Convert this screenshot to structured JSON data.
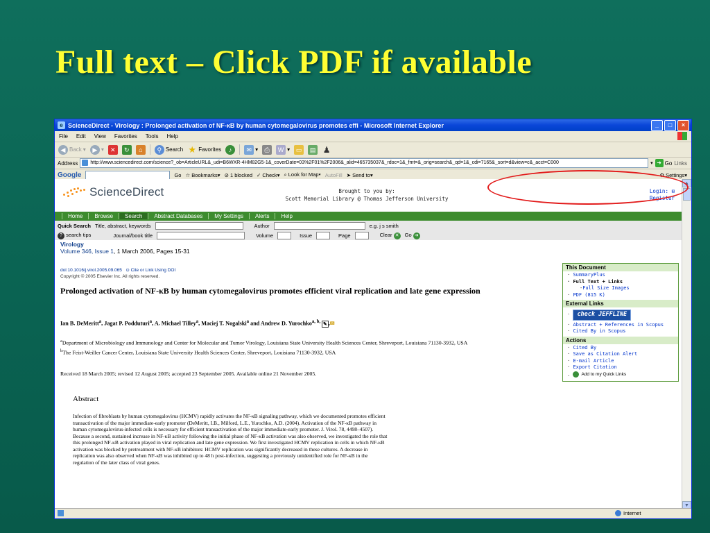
{
  "slide": {
    "title": "Full text – Click PDF if  available"
  },
  "browser": {
    "window_title": "ScienceDirect - Virology : Prolonged activation of NF-κB by human cytomegalovirus promotes effi - Microsoft Internet Explorer",
    "menu": [
      "File",
      "Edit",
      "View",
      "Favorites",
      "Tools",
      "Help"
    ],
    "toolbar": {
      "back": "Back",
      "search": "Search",
      "favorites": "Favorites"
    },
    "address": {
      "label": "Address",
      "url": "http://www.sciencedirect.com/science?_ob=ArticleURL&_udi=B6WXR-4HM82G5-1&_coverDate=03%2F01%2F2006&_alid=465735037&_rdoc=1&_fmt=&_orig=search&_qd=1&_cdi=7165&_sort=d&view=c&_acct=C000",
      "go": "Go",
      "links": "Links"
    },
    "google": {
      "logo": "Google",
      "go": "Go",
      "bookmarks": "Bookmarks",
      "blocked": "1 blocked",
      "check": "Check",
      "lookup": "Look for Map",
      "autofill": "AutoFill",
      "sendto": "Send to",
      "settings": "Settings"
    },
    "status": {
      "zone": "Internet"
    }
  },
  "page": {
    "logo": "ScienceDirect",
    "brought_by": "Brought to you by:",
    "library": "Scott Memorial Library @ Thomas Jefferson University",
    "login": "Login:",
    "register": "Register",
    "nav": [
      "Home",
      "Browse",
      "Search",
      "Abstract Databases",
      "My Settings",
      "Alerts",
      "Help"
    ],
    "quick_search": {
      "label": "Quick Search",
      "field1": "Title, abstract, keywords",
      "author": "Author",
      "example": "e.g. j s smith",
      "tips": "search tips",
      "journal": "Journal/book title",
      "volume": "Volume",
      "issue": "Issue",
      "page": "Page",
      "clear": "Clear",
      "go": "Go"
    },
    "journal": {
      "name": "Virology",
      "volume_issue": "Volume 346, Issue 1",
      "date_pages": ", 1 March 2006, Pages 15-31"
    },
    "doi": "doi:10.1016/j.virol.2005.09.065",
    "cite_link": "Cite or Link Using DOI",
    "copyright": "Copyright © 2005 Elsevier Inc. All rights reserved.",
    "article_title": "Prolonged activation of NF-κB by human cytomegalovirus promotes efficient viral replication and late gene expression",
    "authors": "Ian B. DeMeritt<sup>a</sup>, Jagat P. Podduturi<sup>a</sup>, A. Michael Tilley<sup>a</sup>, Maciej T. Nogalski<sup>a</sup> and Andrew D. Yurochko<sup>a, b, </sup>",
    "affil_a": "Department of Microbiology and Immunology and Center for Molecular and Tumor Virology, Louisiana State University Health Sciences Center, Shreveport, Louisiana 71130-3932, USA",
    "affil_b": "The Feist-Weiller Cancer Center, Louisiana State University Health Sciences Center, Shreveport, Louisiana 71130-3932, USA",
    "received": "Received 18 March 2005;  revised 12 August 2005;  accepted 23 September 2005.  Available online 21 November 2005.",
    "abstract_heading": "Abstract",
    "abstract": "Infection of fibroblasts by human cytomegalovirus (HCMV) rapidly activates the NF-κB signaling pathway, which we documented promotes efficient transactivation of the major immediate-early promoter (DeMeritt, I.B., Milford, L.E., Yurochko, A.D. (2004). Activation of the NF-κB pathway in human cytomegalovirus-infected cells is necessary for efficient transactivation of the major immediate-early promoter. J. Virol. 78, 4498–4507). Because a second, sustained increase in NF-κB activity following the initial phase of NF-κB activation was also observed, we investigated the role that this prolonged NF-κB activation played in viral replication and late gene expression. We first investigated HCMV replication in cells in which NF-κB activation was blocked by pretreatment with NF-κB inhibitors: HCMV replication was significantly decreased in these cultures. A decrease in replication was also observed when NF-κB was inhibited up to 48 h post-infection, suggesting a previously unidentified role for NF-κB in the regulation of the later class of viral genes.",
    "sidebar": {
      "this_document": "This Document",
      "summary_plus": "SummaryPlus",
      "full_text": "Full Text + Links",
      "full_size": "Full Size Images",
      "pdf": "PDF (815 K)",
      "external_links": "External Links",
      "jeffline": "check JEFFLINE",
      "abstract_refs": "Abstract + References in Scopus",
      "cited_scopus": "Cited By in Scopus",
      "actions": "Actions",
      "cited_by": "Cited By",
      "save_alert": "Save as Citation Alert",
      "email": "E-mail Article",
      "export": "Export Citation",
      "quick_links": "Add to my Quick Links"
    }
  }
}
